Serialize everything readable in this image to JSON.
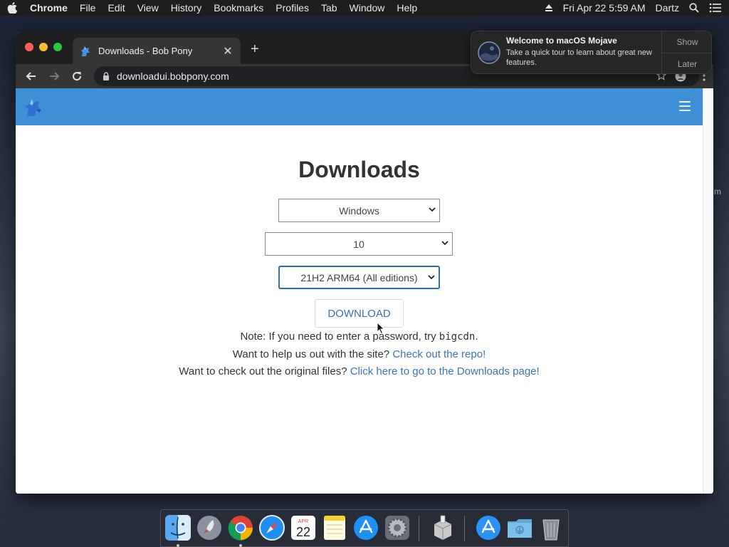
{
  "menubar": {
    "app_name": "Chrome",
    "items": [
      "File",
      "Edit",
      "View",
      "History",
      "Bookmarks",
      "Profiles",
      "Tab",
      "Window",
      "Help"
    ],
    "datetime": "Fri Apr 22  5:59 AM",
    "user": "Dartz"
  },
  "browser": {
    "tab_title": "Downloads - Bob Pony",
    "new_tab_symbol": "+",
    "url": "downloadui.bobpony.com"
  },
  "notification": {
    "title": "Welcome to macOS Mojave",
    "body": "Take a quick tour to learn about great new features.",
    "show_label": "Show",
    "later_label": "Later"
  },
  "page": {
    "heading": "Downloads",
    "os_select": "Windows",
    "version_select": "10",
    "build_select": "21H2 ARM64 (All editions)",
    "download_label": "DOWNLOAD",
    "note_prefix": "Note: If you need to enter a password, try ",
    "note_password": "bigcdn",
    "note_suffix": ".",
    "help_prefix": "Want to help us out with the site? ",
    "help_link": "Check out the repo!",
    "original_prefix": "Want to check out the original files? ",
    "original_link": "Click here to go to the Downloads page!"
  },
  "dock": {
    "calendar_month": "APR",
    "calendar_day": "22"
  },
  "colors": {
    "site_header": "#3f8fd6",
    "link": "#3f72b6",
    "focus_ring": "#2c6bb5"
  },
  "icons": [
    "apple-icon",
    "eject-icon",
    "search-icon",
    "list-icon",
    "lock-icon",
    "star-icon",
    "profile-icon",
    "more-icon",
    "menu-icon"
  ]
}
